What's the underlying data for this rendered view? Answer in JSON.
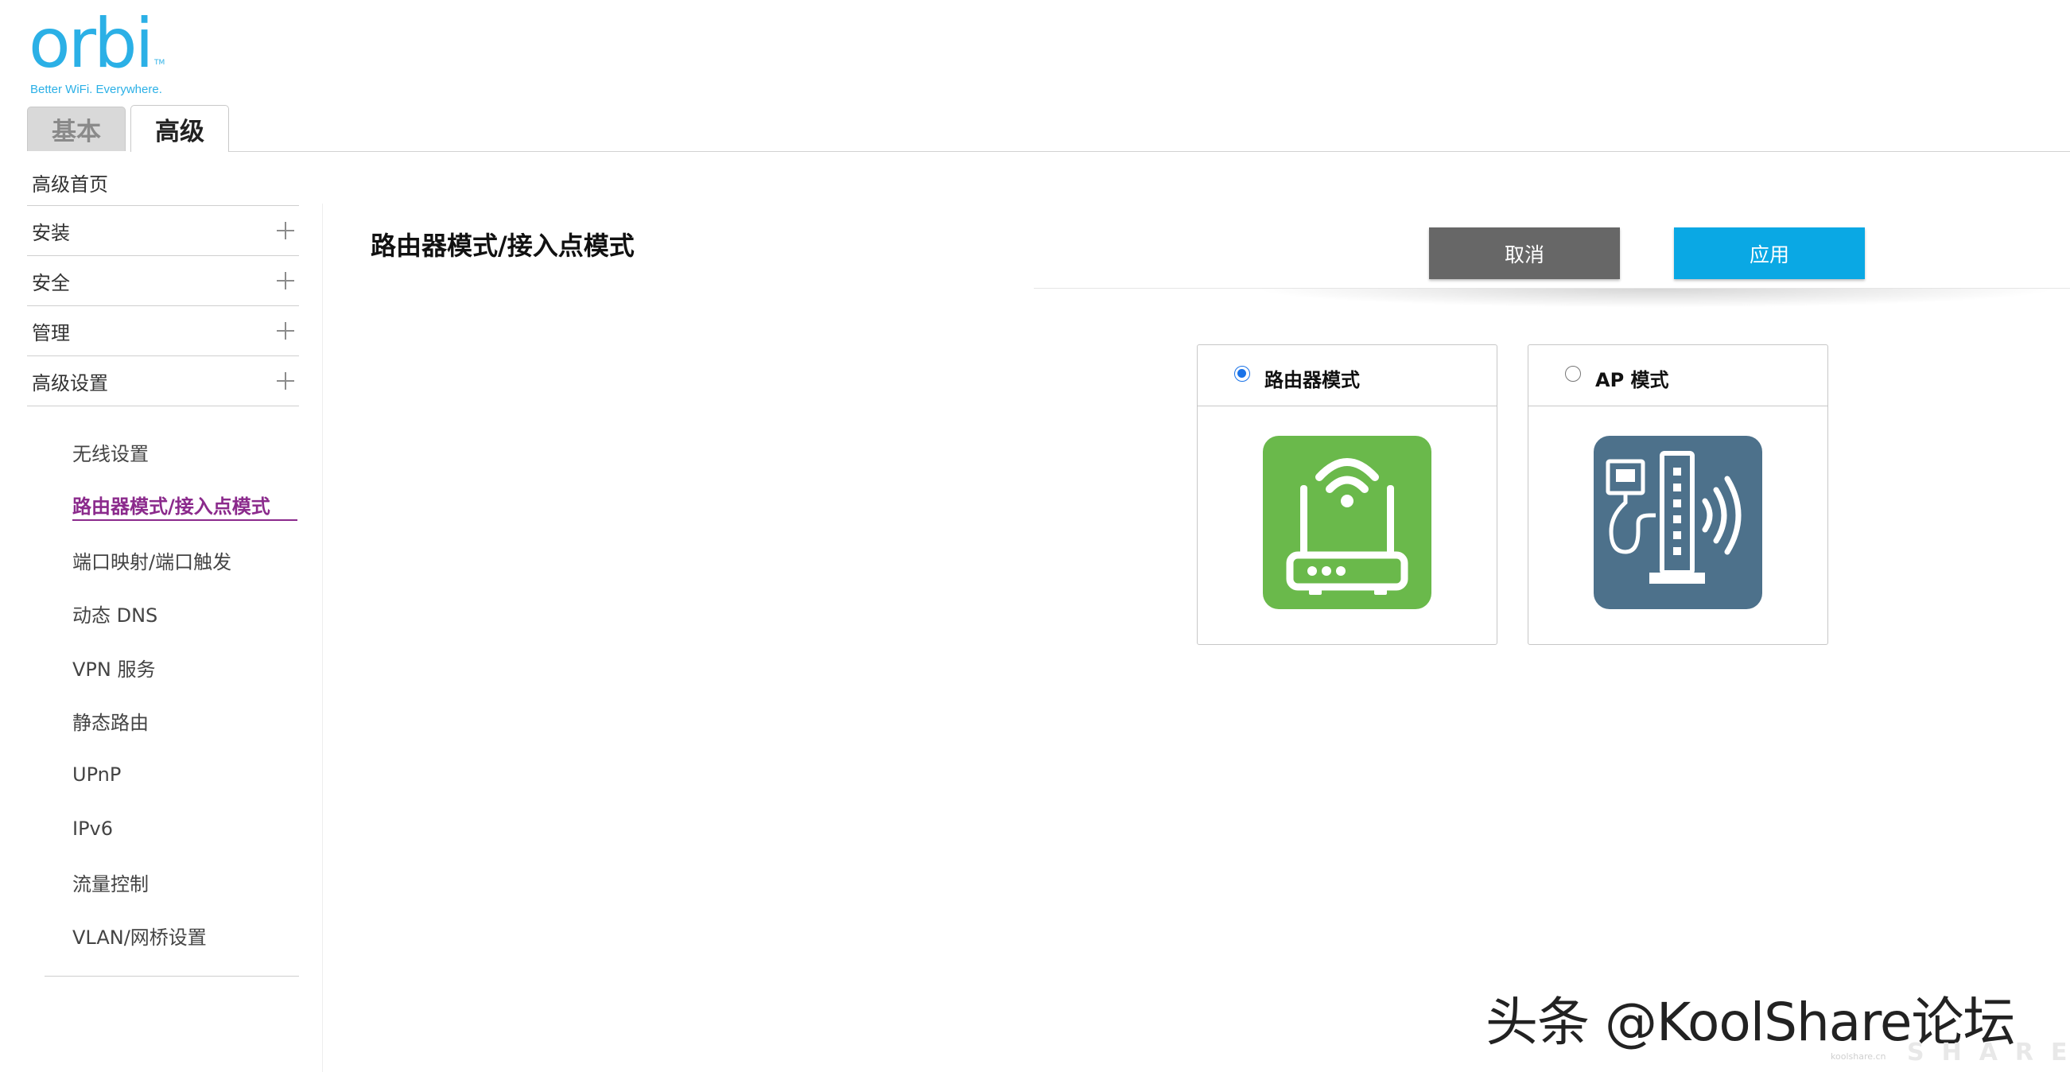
{
  "brand": {
    "logo_text": "orbi",
    "trademark": "TM",
    "tagline": "Better WiFi. Everywhere.",
    "color": "#2bb0e6"
  },
  "tabs": [
    {
      "label": "基本",
      "active": false
    },
    {
      "label": "高级",
      "active": true
    }
  ],
  "sidebar": {
    "home": "高级首页",
    "groups": [
      {
        "label": "安装",
        "icon": "plus-icon"
      },
      {
        "label": "安全",
        "icon": "plus-icon"
      },
      {
        "label": "管理",
        "icon": "plus-icon"
      },
      {
        "label": "高级设置",
        "icon": "plus-icon"
      }
    ],
    "sub_items": [
      {
        "label": "无线设置"
      },
      {
        "label": "路由器模式/接入点模式",
        "active": true
      },
      {
        "label": "端口映射/端口触发"
      },
      {
        "label": "动态 DNS"
      },
      {
        "label": "VPN 服务"
      },
      {
        "label": "静态路由"
      },
      {
        "label": "UPnP"
      },
      {
        "label": "IPv6"
      },
      {
        "label": "流量控制"
      },
      {
        "label": "VLAN/网桥设置"
      }
    ],
    "active_color": "#8b2a8c"
  },
  "main": {
    "title": "路由器模式/接入点模式",
    "cancel_label": "取消",
    "apply_label": "应用",
    "cancel_color": "#676767",
    "apply_color": "#0aa8e4",
    "modes": [
      {
        "label": "路由器模式",
        "selected": true,
        "icon": "router-icon",
        "color": "#6ab94b"
      },
      {
        "label": "AP 模式",
        "selected": false,
        "icon": "access-point-icon",
        "color": "#4d718b"
      }
    ]
  },
  "watermark": {
    "text": "头条 @KoolShare论坛",
    "sub": "SHARE",
    "tiny": "koolshare.cn"
  }
}
